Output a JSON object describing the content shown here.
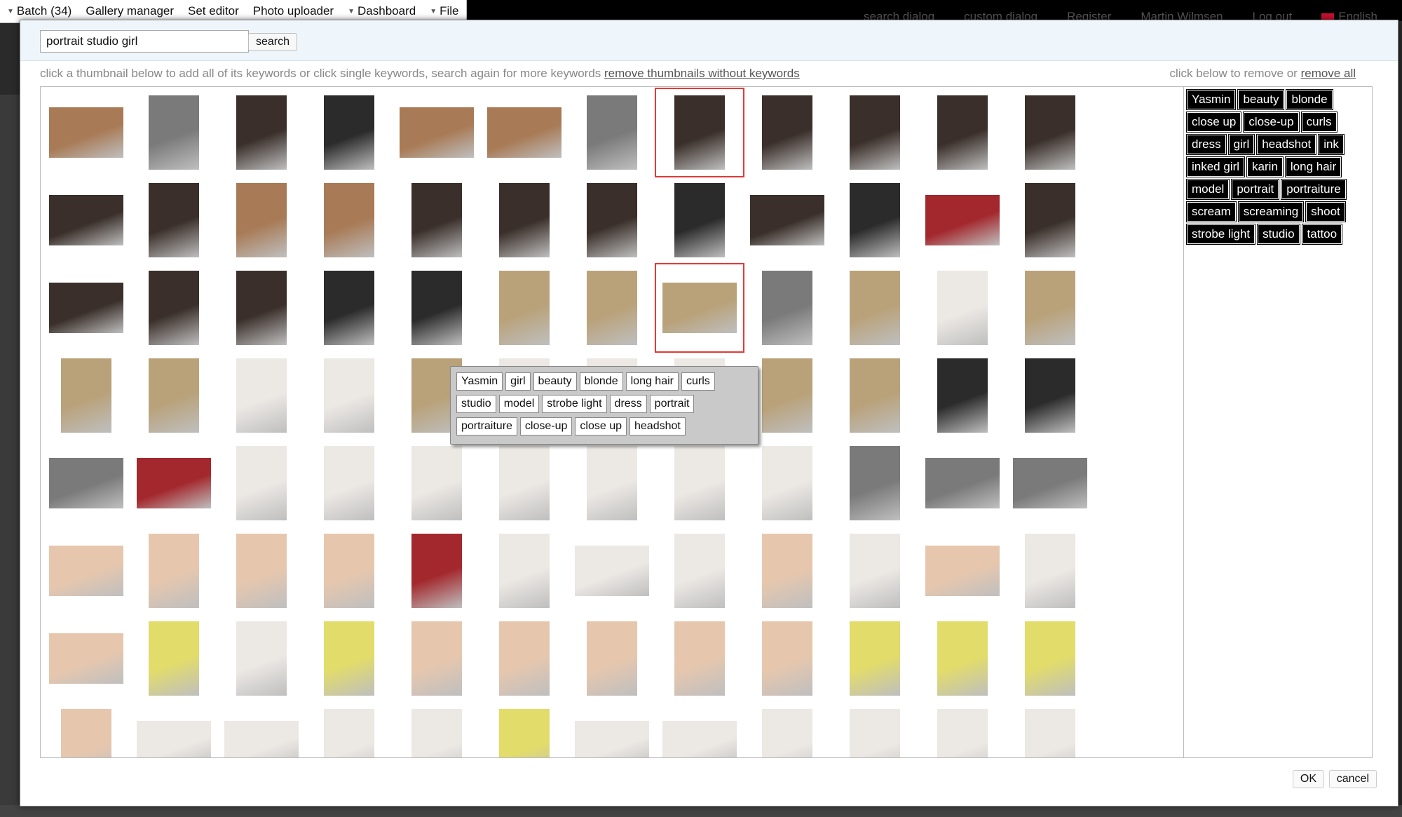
{
  "menubar": {
    "items": [
      {
        "label": "Batch (34)",
        "has_caret": true
      },
      {
        "label": "Gallery manager",
        "has_caret": false
      },
      {
        "label": "Set editor",
        "has_caret": false
      },
      {
        "label": "Photo uploader",
        "has_caret": false
      },
      {
        "label": "Dashboard",
        "has_caret": true
      },
      {
        "label": "File",
        "has_caret": true
      }
    ],
    "right_links": [
      "search dialog",
      "custom dialog",
      "Register",
      "Martin Wilmsen",
      "Log out",
      "English"
    ]
  },
  "search": {
    "value": "portrait studio girl",
    "button_label": "search"
  },
  "hint": {
    "text": "click a thumbnail below to add all of its keywords or click single keywords, search again for more keywords ",
    "link": "remove thumbnails without keywords"
  },
  "remove_hint": {
    "text": "click below to remove or ",
    "link": "remove all"
  },
  "selected_keywords": [
    "Yasmin",
    "beauty",
    "blonde",
    "close up",
    "close-up",
    "curls",
    "dress",
    "girl",
    "headshot",
    "ink",
    "inked girl",
    "karin",
    "long hair",
    "model",
    "portrait",
    "portraiture",
    "scream",
    "screaming",
    "shoot",
    "strobe light",
    "studio",
    "tattoo"
  ],
  "tooltip_keywords": [
    "Yasmin",
    "girl",
    "beauty",
    "blonde",
    "long hair",
    "curls",
    "studio",
    "model",
    "strobe light",
    "dress",
    "portrait",
    "portraiture",
    "close-up",
    "close up",
    "headshot"
  ],
  "thumb_palette": {
    "dark": "#2b2b2b",
    "tattoo": "#3a2f2a",
    "warm": "#a87a55",
    "blonde": "#b9a27a",
    "white": "#ece8e4",
    "baby": "#e6c7ae",
    "red": "#a3282d",
    "yellow": "#e2dc6a",
    "bw": "#7a7a7a"
  },
  "thumb_rows": [
    [
      "warm:l",
      "bw:p",
      "tattoo:p",
      "dark:p",
      "warm:l",
      "warm:l",
      "bw:p",
      "tattoo:p:sel",
      "tattoo:p",
      "tattoo:p",
      "tattoo:p",
      "tattoo:p"
    ],
    [
      "tattoo:l",
      "tattoo:p",
      "warm:p",
      "warm:p",
      "tattoo:p",
      "tattoo:p",
      "tattoo:p",
      "dark:p",
      "tattoo:l",
      "dark:p",
      "red:l",
      "tattoo:p"
    ],
    [
      "tattoo:l",
      "tattoo:p",
      "tattoo:p",
      "dark:p",
      "dark:p",
      "blonde:p",
      "blonde:p",
      "blonde:l:sel",
      "bw:p",
      "blonde:p",
      "white:p",
      "blonde:p"
    ],
    [
      "blonde:p",
      "blonde:p",
      "white:p",
      "white:p",
      "blonde:p",
      "white:p",
      "white:p",
      "white:p",
      "blonde:p",
      "blonde:p",
      "dark:p",
      "dark:p"
    ],
    [
      "bw:l",
      "red:l",
      "white:p",
      "white:p",
      "white:p",
      "white:p",
      "white:p",
      "white:p",
      "white:p",
      "bw:p",
      "bw:l",
      "bw:l"
    ],
    [
      "baby:l",
      "baby:p",
      "baby:p",
      "baby:p",
      "red:p",
      "white:p",
      "white:l",
      "white:p",
      "baby:p",
      "white:p",
      "baby:l",
      "white:p"
    ],
    [
      "baby:l",
      "yellow:p",
      "white:p",
      "yellow:p",
      "baby:p",
      "baby:p",
      "baby:p",
      "baby:p",
      "baby:p",
      "yellow:p",
      "yellow:p",
      "yellow:p"
    ],
    [
      "baby:p",
      "white:l",
      "white:l",
      "white:p",
      "white:p",
      "yellow:p",
      "white:l",
      "white:l",
      "white:p",
      "white:p",
      "white:p",
      "white:p"
    ]
  ],
  "dialog_buttons": {
    "ok": "OK",
    "cancel": "cancel"
  }
}
